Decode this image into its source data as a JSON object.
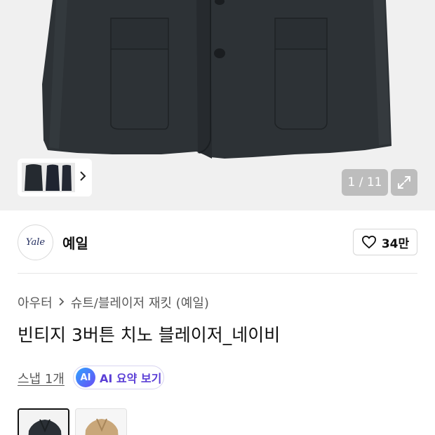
{
  "gallery": {
    "counter": "1 / 11",
    "thumb_icon": "chevron-right-icon",
    "expand_icon": "expand-icon"
  },
  "brand": {
    "logo_text": "Yale",
    "name": "예일",
    "like_icon": "heart-icon",
    "like_count": "34만"
  },
  "product": {
    "breadcrumb": [
      "아우터",
      "슈트/블레이저 재킷 (예일)"
    ],
    "breadcrumb_separator_icon": "chevron-right-icon",
    "title": "빈티지 3버튼 치노 블레이저_네이비",
    "snap_link": "스냅 1개",
    "ai_badge": "AI",
    "ai_summary_label": "AI 요약 보기"
  },
  "color_options": [
    {
      "name": "navy",
      "color": "#2b3036",
      "selected": true
    },
    {
      "name": "beige",
      "color": "#c9a77a",
      "selected": false
    }
  ],
  "colors": {
    "jacket": "#2d3236",
    "hero_bg": "#f0f0f0",
    "accent_purple": "#5b3fd6"
  }
}
